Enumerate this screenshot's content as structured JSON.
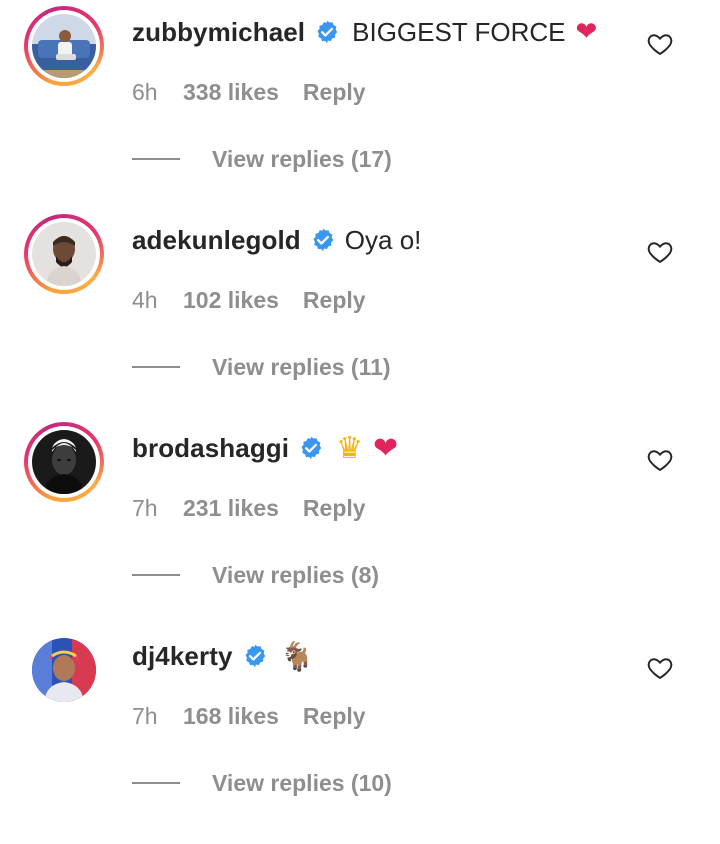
{
  "comments": [
    {
      "username": "zubbymichael",
      "text": "BIGGEST FORCE",
      "emoji": "❤",
      "time": "6h",
      "likes": "338 likes",
      "reply": "Reply",
      "view_replies": "View replies (17)",
      "verified": true,
      "avatar_icon": "avatar-photo",
      "has_story_ring": true
    },
    {
      "username": "adekunlegold",
      "text": "Oya o!",
      "time": "4h",
      "likes": "102 likes",
      "reply": "Reply",
      "view_replies": "View replies (11)",
      "verified": true,
      "avatar_icon": "avatar-photo",
      "has_story_ring": true
    },
    {
      "username": "brodashaggi",
      "emoji": "♛",
      "emoji2": "❤",
      "time": "7h",
      "likes": "231 likes",
      "reply": "Reply",
      "view_replies": "View replies (8)",
      "verified": true,
      "avatar_icon": "avatar-photo",
      "has_story_ring": true
    },
    {
      "username": "dj4kerty",
      "emoji": "🐐",
      "time": "7h",
      "likes": "168 likes",
      "reply": "Reply",
      "view_replies": "View replies (10)",
      "verified": true,
      "avatar_icon": "avatar-photo",
      "has_story_ring": false
    }
  ],
  "icons": {
    "verified": "verified-badge-icon",
    "like": "heart-outline-icon"
  },
  "colors": {
    "primary_text": "#262626",
    "secondary_text": "#8e8e8e",
    "verified_blue": "#3897f0",
    "story_ring_start": "#f9a13a",
    "story_ring_end": "#c3287f"
  }
}
